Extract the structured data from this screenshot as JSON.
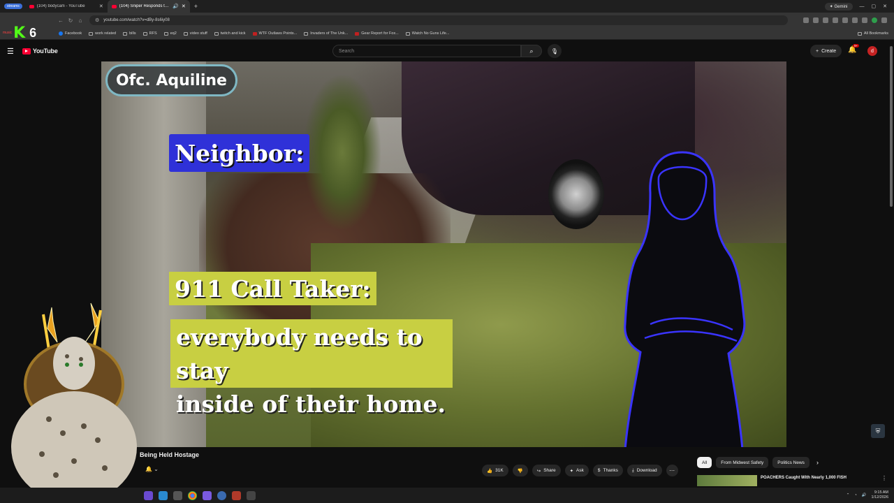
{
  "browser": {
    "tab_group": "streams",
    "tabs": [
      {
        "title": "(104) bodycam - YouTube",
        "active": false
      },
      {
        "title": "(104) Sniper Responds to C",
        "active": true
      }
    ],
    "gemini": "Gemini",
    "url": "youtube.com/watch?v=dBy-8s6iy08",
    "bookmarks": [
      "Facebook",
      "work related",
      "bills",
      "RFS",
      "eq2",
      "video stuff",
      "twitch and kick",
      "WTF Outlaws Points...",
      "Invaders of The Unk...",
      "Gear Report for Fox...",
      "Watch No Guns Life..."
    ],
    "all_bookmarks": "All Bookmarks"
  },
  "stream": {
    "small_label": "music",
    "logo_letter": "K",
    "logo_number": "6"
  },
  "youtube": {
    "logo": "YouTube",
    "search_placeholder": "Search",
    "create": "Create",
    "notif_badge": "9+",
    "avatar": "d"
  },
  "video": {
    "badge": "Ofc. Aquiline",
    "neighbor_label": "Neighbor:",
    "caller_label": "911 Call Taker:",
    "caption": "everybody needs to stay\ninside of their home."
  },
  "below": {
    "title": "Being Held Hostage",
    "actions": {
      "likes": "31K",
      "share": "Share",
      "ask": "Ask",
      "thanks": "Thanks",
      "download": "Download"
    },
    "chips": [
      "All",
      "From Midwest Safety",
      "Politics News"
    ],
    "rec_title": "POACHERS Caught With Nearly 1,000 FISH"
  },
  "taskbar": {
    "time": "9:15 AM",
    "date": "1/12/2026"
  },
  "colors": {
    "accent_red": "#ff0033",
    "neighbor_bg": "#2f31d8",
    "caller_bg": "#c8cf42",
    "badge_border": "#7fb8c4",
    "kick_green": "#53fc18"
  }
}
